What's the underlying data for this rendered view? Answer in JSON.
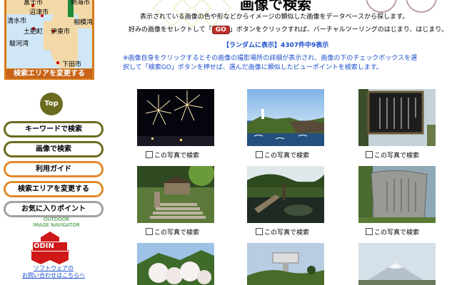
{
  "map": {
    "cities": [
      "富士市",
      "沼津市",
      "熱海市",
      "清水市",
      "土肥町",
      "伊東市",
      "相模湾",
      "駿河湾",
      "下田市"
    ],
    "area_button": "検索エリアを変更する"
  },
  "sidebar": {
    "top_label": "Top",
    "items": [
      {
        "label": "キーワードで検索"
      },
      {
        "label": "画像で検索"
      },
      {
        "label": "利用ガイド"
      },
      {
        "label": "検索エリアを変更する"
      },
      {
        "label": "お気に入りポイント"
      }
    ],
    "outdoor_line1": "OUTDOOR",
    "outdoor_line2": "IMAGE NAVIGATOR",
    "odin_text": "ODIN",
    "support_line1": "ソフトウェアの",
    "support_line2": "お問い合わせはこちらへ"
  },
  "header": {
    "title": "画像で検索"
  },
  "intro": {
    "line1": "表示されている画像の色や形などからイメージの類似した画像をデータベースから探します。",
    "line2_a": "好みの画像をセレクトして「",
    "go": "GO",
    "line2_b": "」ボタンをクリックすれば、バーチャルツーリングのはじまり、はじまり。"
  },
  "random": {
    "text": "【ランダムに表示】4307件中9表示"
  },
  "note": {
    "line1": "※画像自身をクリックするとその画像の撮影場所の詳細が表示され、画像の下のチェックボックスを選",
    "line2": "択して「検索GO」ボタンを押せば、選んだ画像に類似したビューポイントを検索します。"
  },
  "results": {
    "check_label": "この写真で検索",
    "items": [
      {
        "image": "fireworks-night-photo"
      },
      {
        "image": "coastal-lighthouse-photo"
      },
      {
        "image": "signboard-photo"
      },
      {
        "image": "temple-stairs-photo"
      },
      {
        "image": "garden-pond-photo"
      },
      {
        "image": "stone-monument-photo"
      },
      {
        "image": "blossom-park-photo"
      },
      {
        "image": "observatory-hill-photo"
      },
      {
        "image": "mount-fuji-photo"
      }
    ]
  },
  "colors": {
    "olive": "#6b6b1f",
    "orange": "#e08a2a",
    "link_blue": "#1a4dcc",
    "go_red": "#c0302a"
  }
}
